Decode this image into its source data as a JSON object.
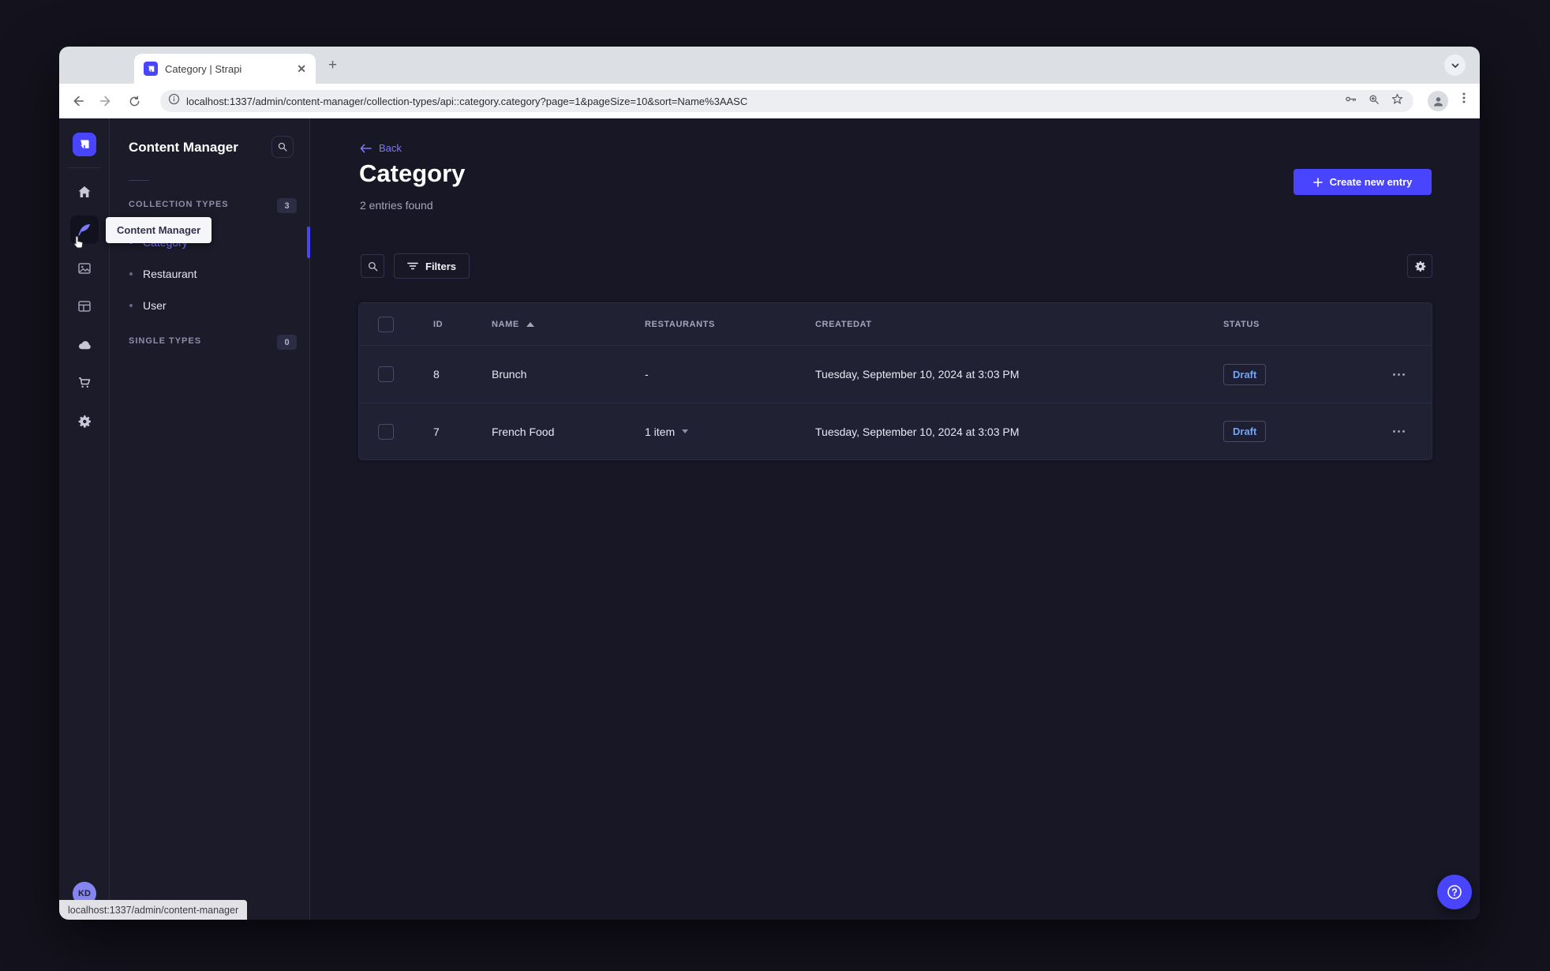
{
  "browser": {
    "tab_title": "Category | Strapi",
    "url": "localhost:1337/admin/content-manager/collection-types/api::category.category?page=1&pageSize=10&sort=Name%3AASC",
    "status_bar": "localhost:1337/admin/content-manager"
  },
  "app": {
    "tooltip": "Content Manager",
    "rail": {
      "avatar": "KD"
    },
    "subnav": {
      "title": "Content Manager",
      "sections": [
        {
          "label": "COLLECTION TYPES",
          "badge": "3",
          "items": [
            {
              "label": "Category",
              "active": true
            },
            {
              "label": "Restaurant",
              "active": false
            },
            {
              "label": "User",
              "active": false
            }
          ]
        },
        {
          "label": "SINGLE TYPES",
          "badge": "0",
          "items": []
        }
      ]
    },
    "main": {
      "back_label": "Back",
      "title": "Category",
      "entries_found": "2 entries found",
      "create_button": "Create new entry",
      "filters_label": "Filters",
      "table": {
        "headers": [
          "ID",
          "NAME",
          "RESTAURANTS",
          "CREATEDAT",
          "STATUS"
        ],
        "rows": [
          {
            "id": "8",
            "name": "Brunch",
            "restaurants": "-",
            "created_at": "Tuesday, September 10, 2024 at 3:03 PM",
            "status": "Draft"
          },
          {
            "id": "7",
            "name": "French Food",
            "restaurants": "1 item",
            "created_at": "Tuesday, September 10, 2024 at 3:03 PM",
            "status": "Draft"
          }
        ]
      }
    }
  },
  "colors": {
    "primary": "#4945ff",
    "link": "#7b79ff",
    "draft_status": "#74a4f3",
    "app_background": "#171725",
    "panel_background": "#1b1b29",
    "card_background": "#212134"
  }
}
